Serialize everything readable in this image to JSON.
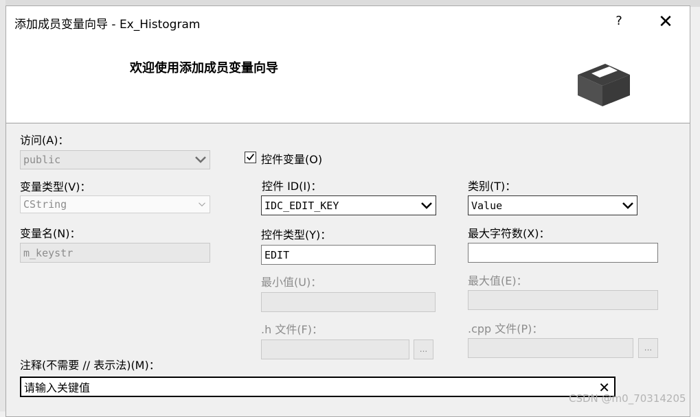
{
  "window": {
    "title": "添加成员变量向导 - Ex_Histogram",
    "help_glyph": "?",
    "close_glyph": "✕"
  },
  "header": {
    "welcome": "欢迎使用添加成员变量向导",
    "icon": "box-icon"
  },
  "access": {
    "label": "访问(A)：",
    "value": "public"
  },
  "var_type": {
    "label": "变量类型(V)：",
    "value": "CString"
  },
  "var_name": {
    "label": "变量名(N)：",
    "value": "m_keystr"
  },
  "control_var": {
    "label": "控件变量(O)",
    "checked": true
  },
  "control_id": {
    "label": "控件 ID(I)：",
    "value": "IDC_EDIT_KEY"
  },
  "category": {
    "label": "类别(T)：",
    "value": "Value"
  },
  "control_type": {
    "label": "控件类型(Y)：",
    "value": "EDIT"
  },
  "max_chars": {
    "label": "最大字符数(X)：",
    "value": ""
  },
  "min_value": {
    "label": "最小值(U)：",
    "value": ""
  },
  "max_value": {
    "label": "最大值(E)：",
    "value": ""
  },
  "h_file": {
    "label": ".h 文件(F)：",
    "value": "",
    "browse_label": "..."
  },
  "cpp_file": {
    "label": ".cpp 文件(P)：",
    "value": "",
    "browse_label": "..."
  },
  "comment": {
    "label": "注释(不需要 // 表示法)(M)：",
    "value": "请输入关键值",
    "clear_glyph": "✕"
  },
  "watermark": "CSDN @m0_70314205"
}
